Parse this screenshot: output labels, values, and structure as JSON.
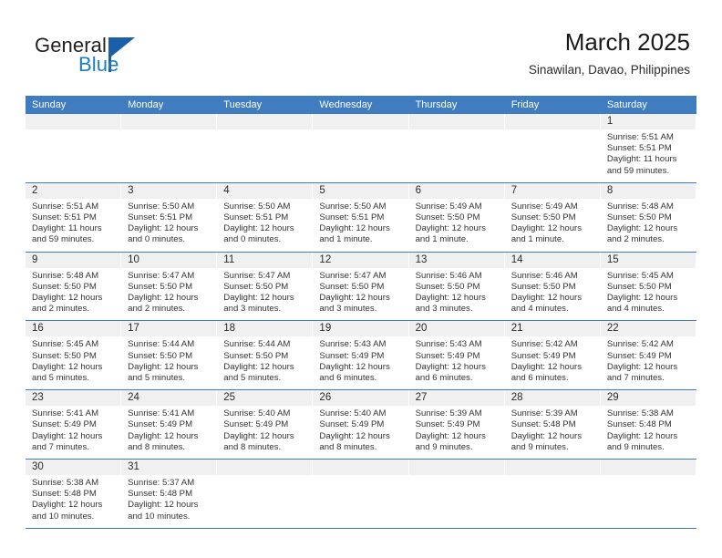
{
  "brand": {
    "name_part1": "General",
    "name_part2": "Blue",
    "colors": {
      "dark": "#231f20",
      "blue": "#1a7fc1",
      "triangle": "#1b5fa8"
    }
  },
  "header": {
    "title": "March 2025",
    "subtitle": "Sinawilan, Davao, Philippines"
  },
  "theme": {
    "header_blue": "#3f7cc0",
    "daynum_band": "#f0f0f0",
    "text": "#333333"
  },
  "weekdays": [
    "Sunday",
    "Monday",
    "Tuesday",
    "Wednesday",
    "Thursday",
    "Friday",
    "Saturday"
  ],
  "weeks": [
    [
      {
        "day": "",
        "sunrise": "",
        "sunset": "",
        "daylight1": "",
        "daylight2": ""
      },
      {
        "day": "",
        "sunrise": "",
        "sunset": "",
        "daylight1": "",
        "daylight2": ""
      },
      {
        "day": "",
        "sunrise": "",
        "sunset": "",
        "daylight1": "",
        "daylight2": ""
      },
      {
        "day": "",
        "sunrise": "",
        "sunset": "",
        "daylight1": "",
        "daylight2": ""
      },
      {
        "day": "",
        "sunrise": "",
        "sunset": "",
        "daylight1": "",
        "daylight2": ""
      },
      {
        "day": "",
        "sunrise": "",
        "sunset": "",
        "daylight1": "",
        "daylight2": ""
      },
      {
        "day": "1",
        "sunrise": "Sunrise: 5:51 AM",
        "sunset": "Sunset: 5:51 PM",
        "daylight1": "Daylight: 11 hours",
        "daylight2": "and 59 minutes."
      }
    ],
    [
      {
        "day": "2",
        "sunrise": "Sunrise: 5:51 AM",
        "sunset": "Sunset: 5:51 PM",
        "daylight1": "Daylight: 11 hours",
        "daylight2": "and 59 minutes."
      },
      {
        "day": "3",
        "sunrise": "Sunrise: 5:50 AM",
        "sunset": "Sunset: 5:51 PM",
        "daylight1": "Daylight: 12 hours",
        "daylight2": "and 0 minutes."
      },
      {
        "day": "4",
        "sunrise": "Sunrise: 5:50 AM",
        "sunset": "Sunset: 5:51 PM",
        "daylight1": "Daylight: 12 hours",
        "daylight2": "and 0 minutes."
      },
      {
        "day": "5",
        "sunrise": "Sunrise: 5:50 AM",
        "sunset": "Sunset: 5:51 PM",
        "daylight1": "Daylight: 12 hours",
        "daylight2": "and 1 minute."
      },
      {
        "day": "6",
        "sunrise": "Sunrise: 5:49 AM",
        "sunset": "Sunset: 5:50 PM",
        "daylight1": "Daylight: 12 hours",
        "daylight2": "and 1 minute."
      },
      {
        "day": "7",
        "sunrise": "Sunrise: 5:49 AM",
        "sunset": "Sunset: 5:50 PM",
        "daylight1": "Daylight: 12 hours",
        "daylight2": "and 1 minute."
      },
      {
        "day": "8",
        "sunrise": "Sunrise: 5:48 AM",
        "sunset": "Sunset: 5:50 PM",
        "daylight1": "Daylight: 12 hours",
        "daylight2": "and 2 minutes."
      }
    ],
    [
      {
        "day": "9",
        "sunrise": "Sunrise: 5:48 AM",
        "sunset": "Sunset: 5:50 PM",
        "daylight1": "Daylight: 12 hours",
        "daylight2": "and 2 minutes."
      },
      {
        "day": "10",
        "sunrise": "Sunrise: 5:47 AM",
        "sunset": "Sunset: 5:50 PM",
        "daylight1": "Daylight: 12 hours",
        "daylight2": "and 2 minutes."
      },
      {
        "day": "11",
        "sunrise": "Sunrise: 5:47 AM",
        "sunset": "Sunset: 5:50 PM",
        "daylight1": "Daylight: 12 hours",
        "daylight2": "and 3 minutes."
      },
      {
        "day": "12",
        "sunrise": "Sunrise: 5:47 AM",
        "sunset": "Sunset: 5:50 PM",
        "daylight1": "Daylight: 12 hours",
        "daylight2": "and 3 minutes."
      },
      {
        "day": "13",
        "sunrise": "Sunrise: 5:46 AM",
        "sunset": "Sunset: 5:50 PM",
        "daylight1": "Daylight: 12 hours",
        "daylight2": "and 3 minutes."
      },
      {
        "day": "14",
        "sunrise": "Sunrise: 5:46 AM",
        "sunset": "Sunset: 5:50 PM",
        "daylight1": "Daylight: 12 hours",
        "daylight2": "and 4 minutes."
      },
      {
        "day": "15",
        "sunrise": "Sunrise: 5:45 AM",
        "sunset": "Sunset: 5:50 PM",
        "daylight1": "Daylight: 12 hours",
        "daylight2": "and 4 minutes."
      }
    ],
    [
      {
        "day": "16",
        "sunrise": "Sunrise: 5:45 AM",
        "sunset": "Sunset: 5:50 PM",
        "daylight1": "Daylight: 12 hours",
        "daylight2": "and 5 minutes."
      },
      {
        "day": "17",
        "sunrise": "Sunrise: 5:44 AM",
        "sunset": "Sunset: 5:50 PM",
        "daylight1": "Daylight: 12 hours",
        "daylight2": "and 5 minutes."
      },
      {
        "day": "18",
        "sunrise": "Sunrise: 5:44 AM",
        "sunset": "Sunset: 5:50 PM",
        "daylight1": "Daylight: 12 hours",
        "daylight2": "and 5 minutes."
      },
      {
        "day": "19",
        "sunrise": "Sunrise: 5:43 AM",
        "sunset": "Sunset: 5:49 PM",
        "daylight1": "Daylight: 12 hours",
        "daylight2": "and 6 minutes."
      },
      {
        "day": "20",
        "sunrise": "Sunrise: 5:43 AM",
        "sunset": "Sunset: 5:49 PM",
        "daylight1": "Daylight: 12 hours",
        "daylight2": "and 6 minutes."
      },
      {
        "day": "21",
        "sunrise": "Sunrise: 5:42 AM",
        "sunset": "Sunset: 5:49 PM",
        "daylight1": "Daylight: 12 hours",
        "daylight2": "and 6 minutes."
      },
      {
        "day": "22",
        "sunrise": "Sunrise: 5:42 AM",
        "sunset": "Sunset: 5:49 PM",
        "daylight1": "Daylight: 12 hours",
        "daylight2": "and 7 minutes."
      }
    ],
    [
      {
        "day": "23",
        "sunrise": "Sunrise: 5:41 AM",
        "sunset": "Sunset: 5:49 PM",
        "daylight1": "Daylight: 12 hours",
        "daylight2": "and 7 minutes."
      },
      {
        "day": "24",
        "sunrise": "Sunrise: 5:41 AM",
        "sunset": "Sunset: 5:49 PM",
        "daylight1": "Daylight: 12 hours",
        "daylight2": "and 8 minutes."
      },
      {
        "day": "25",
        "sunrise": "Sunrise: 5:40 AM",
        "sunset": "Sunset: 5:49 PM",
        "daylight1": "Daylight: 12 hours",
        "daylight2": "and 8 minutes."
      },
      {
        "day": "26",
        "sunrise": "Sunrise: 5:40 AM",
        "sunset": "Sunset: 5:49 PM",
        "daylight1": "Daylight: 12 hours",
        "daylight2": "and 8 minutes."
      },
      {
        "day": "27",
        "sunrise": "Sunrise: 5:39 AM",
        "sunset": "Sunset: 5:49 PM",
        "daylight1": "Daylight: 12 hours",
        "daylight2": "and 9 minutes."
      },
      {
        "day": "28",
        "sunrise": "Sunrise: 5:39 AM",
        "sunset": "Sunset: 5:48 PM",
        "daylight1": "Daylight: 12 hours",
        "daylight2": "and 9 minutes."
      },
      {
        "day": "29",
        "sunrise": "Sunrise: 5:38 AM",
        "sunset": "Sunset: 5:48 PM",
        "daylight1": "Daylight: 12 hours",
        "daylight2": "and 9 minutes."
      }
    ],
    [
      {
        "day": "30",
        "sunrise": "Sunrise: 5:38 AM",
        "sunset": "Sunset: 5:48 PM",
        "daylight1": "Daylight: 12 hours",
        "daylight2": "and 10 minutes."
      },
      {
        "day": "31",
        "sunrise": "Sunrise: 5:37 AM",
        "sunset": "Sunset: 5:48 PM",
        "daylight1": "Daylight: 12 hours",
        "daylight2": "and 10 minutes."
      },
      {
        "day": "",
        "sunrise": "",
        "sunset": "",
        "daylight1": "",
        "daylight2": ""
      },
      {
        "day": "",
        "sunrise": "",
        "sunset": "",
        "daylight1": "",
        "daylight2": ""
      },
      {
        "day": "",
        "sunrise": "",
        "sunset": "",
        "daylight1": "",
        "daylight2": ""
      },
      {
        "day": "",
        "sunrise": "",
        "sunset": "",
        "daylight1": "",
        "daylight2": ""
      },
      {
        "day": "",
        "sunrise": "",
        "sunset": "",
        "daylight1": "",
        "daylight2": ""
      }
    ]
  ]
}
